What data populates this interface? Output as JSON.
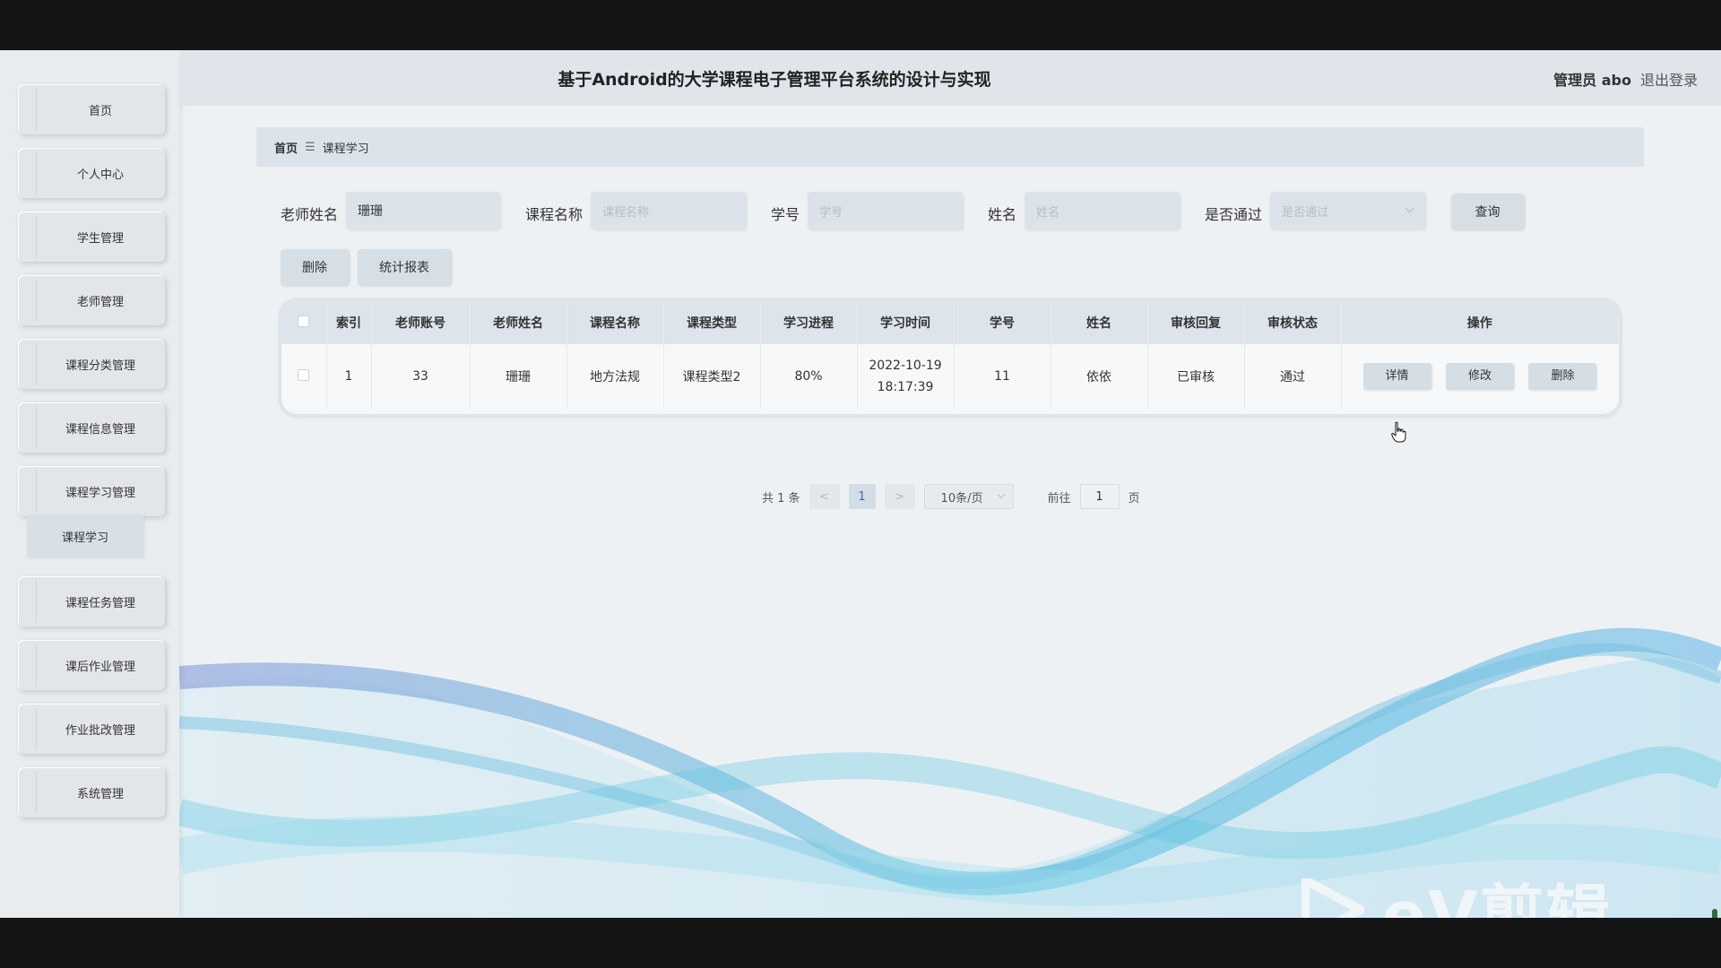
{
  "header": {
    "title": "基于Android的大学课程电子管理平台系统的设计与实现",
    "user": "管理员 abo",
    "logout": "退出登录"
  },
  "sidebar": {
    "items": [
      {
        "label": "首页"
      },
      {
        "label": "个人中心"
      },
      {
        "label": "学生管理"
      },
      {
        "label": "老师管理"
      },
      {
        "label": "课程分类管理"
      },
      {
        "label": "课程信息管理"
      },
      {
        "label": "课程学习管理"
      },
      {
        "label": "课程任务管理"
      },
      {
        "label": "课后作业管理"
      },
      {
        "label": "作业批改管理"
      },
      {
        "label": "系统管理"
      }
    ],
    "sub_item": "课程学习"
  },
  "breadcrumb": {
    "home": "首页",
    "separator": "☰",
    "current": "课程学习"
  },
  "search": {
    "teacher_name_label": "老师姓名",
    "teacher_name_value": "珊珊",
    "course_name_label": "课程名称",
    "course_name_placeholder": "课程名称",
    "student_id_label": "学号",
    "student_id_placeholder": "学号",
    "name_label": "姓名",
    "name_placeholder": "姓名",
    "passed_label": "是否通过",
    "passed_placeholder": "是否通过",
    "query_button": "查询"
  },
  "actions": {
    "delete": "删除",
    "report": "统计报表"
  },
  "table": {
    "columns": [
      "索引",
      "老师账号",
      "老师姓名",
      "课程名称",
      "课程类型",
      "学习进程",
      "学习时间",
      "学号",
      "姓名",
      "审核回复",
      "审核状态",
      "操作"
    ],
    "rows": [
      {
        "index": "1",
        "teacher_account": "33",
        "teacher_name": "珊珊",
        "course_name": "地方法规",
        "course_type": "课程类型2",
        "progress": "80%",
        "date": "2022-10-19",
        "time": "18:17:39",
        "student_id": "11",
        "name": "依依",
        "review_reply": "已审核",
        "review_status": "通过",
        "op_detail": "详情",
        "op_edit": "修改",
        "op_delete": "删除"
      }
    ]
  },
  "pagination": {
    "total": "共 1 条",
    "prev": "<",
    "current_page": "1",
    "next": ">",
    "page_size": "10条/页",
    "goto_label": "前往",
    "goto_value": "1",
    "goto_suffix": "页"
  },
  "watermark": {
    "text": "eV剪辑"
  },
  "colors": {
    "accent": "#3a6ea5",
    "button_bg": "#d6dee6",
    "header_bg": "#dfe5ea"
  }
}
